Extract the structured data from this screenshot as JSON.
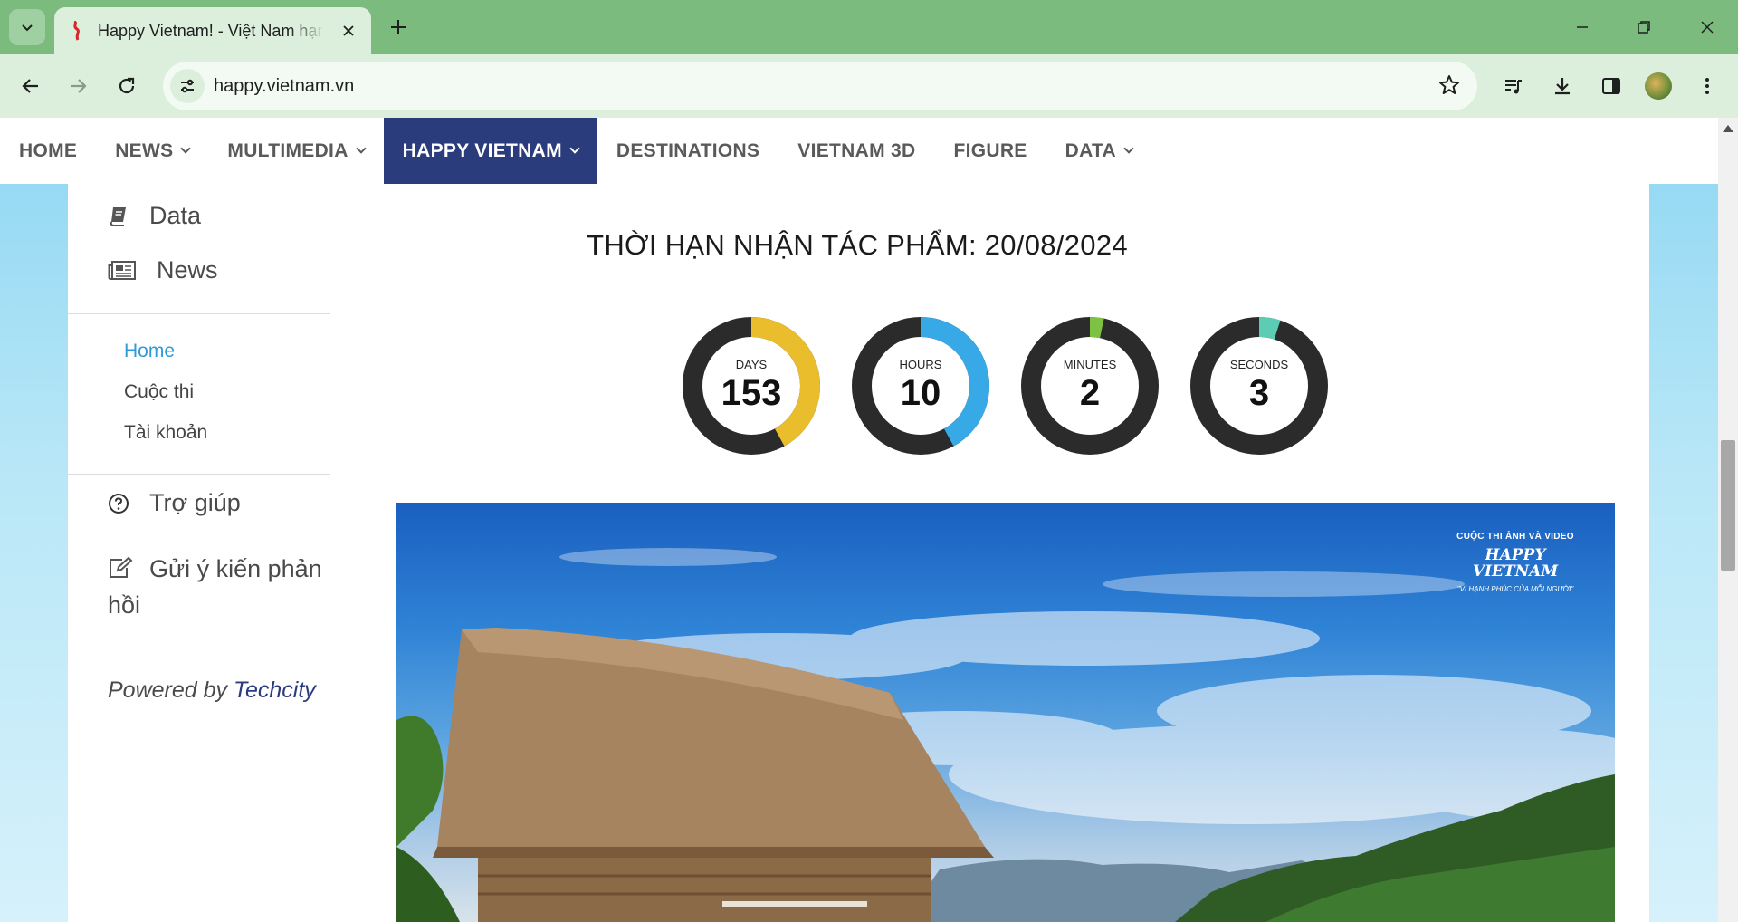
{
  "browser": {
    "tab_title": "Happy Vietnam! - Việt Nam hạnh phúc",
    "url": "happy.vietnam.vn",
    "colors": {
      "frame": "#7bbb7e",
      "toolbar": "#dcefdc"
    }
  },
  "site_nav": {
    "items": [
      {
        "label": "HOME",
        "dropdown": false
      },
      {
        "label": "NEWS",
        "dropdown": true
      },
      {
        "label": "MULTIMEDIA",
        "dropdown": true
      },
      {
        "label": "HAPPY VIETNAM",
        "dropdown": true,
        "active": true
      },
      {
        "label": "DESTINATIONS",
        "dropdown": false
      },
      {
        "label": "VIETNAM 3D",
        "dropdown": false
      },
      {
        "label": "FIGURE",
        "dropdown": false
      },
      {
        "label": "DATA",
        "dropdown": true
      }
    ],
    "active_color": "#2a3c7b"
  },
  "sidebar": {
    "data_label": "Data",
    "news_label": "News",
    "sub_links": [
      {
        "label": "Home",
        "current": true
      },
      {
        "label": "Cuộc thi"
      },
      {
        "label": "Tài khoản"
      }
    ],
    "help_label": "Trợ giúp",
    "feedback_label": "Gửi ý kiến phản hồi",
    "powered_prefix": "Powered by",
    "powered_brand": "Techcity"
  },
  "countdown": {
    "title": "THỜI HẠN NHẬN TÁC PHẨM: 20/08/2024",
    "timers": [
      {
        "label": "DAYS",
        "value": "153",
        "fraction": 0.42,
        "color": "#e9bd2c"
      },
      {
        "label": "HOURS",
        "value": "10",
        "fraction": 0.42,
        "color": "#37a9e6"
      },
      {
        "label": "MINUTES",
        "value": "2",
        "fraction": 0.033,
        "color": "#7dc242"
      },
      {
        "label": "SECONDS",
        "value": "3",
        "fraction": 0.05,
        "color": "#5ccdb4"
      }
    ]
  },
  "banner": {
    "logo_top": "CUỘC THI ẢNH VÀ VIDEO",
    "logo_main": "HAPPY VIETNAM",
    "logo_sub": "\"VÌ HẠNH PHÚC CỦA MỖI NGƯỜI\""
  }
}
